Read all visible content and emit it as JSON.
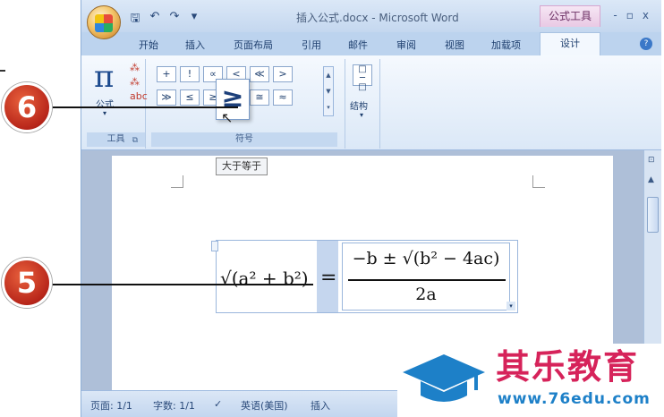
{
  "window": {
    "title": "插入公式.docx - Microsoft Word",
    "context_tab_group": "公式工具",
    "controls": [
      "-",
      "▫",
      "x"
    ]
  },
  "quick_access": [
    "save-icon",
    "undo-icon",
    "redo-icon",
    "customize-icon"
  ],
  "tabs": [
    {
      "label": "开始"
    },
    {
      "label": "插入"
    },
    {
      "label": "页面布局"
    },
    {
      "label": "引用"
    },
    {
      "label": "邮件"
    },
    {
      "label": "审阅"
    },
    {
      "label": "视图"
    },
    {
      "label": "加载项"
    },
    {
      "label": "设计",
      "active": true
    }
  ],
  "ribbon": {
    "tools": {
      "big_icon": "π",
      "button_label": "公式",
      "group_label": "工具"
    },
    "symbols": {
      "group_label": "符号",
      "row1": [
        "+",
        "!",
        "∝",
        "<",
        "≪",
        ">"
      ],
      "row2": [
        "≫",
        "≤",
        "≥",
        "∓",
        "≅",
        "≈"
      ],
      "hovered": "≥"
    },
    "structures": {
      "button_label": "结构"
    }
  },
  "tooltip": "大于等于",
  "equation": {
    "left": "√(a² + b²)",
    "equals": "=",
    "numerator": "−b ± √(b² − 4ac)",
    "denominator": "2a"
  },
  "statusbar": {
    "page": "页面: 1/1",
    "words": "字数: 1/1",
    "language": "英语(美国)",
    "mode": "插入"
  },
  "callouts": {
    "step6": "6",
    "step5": "5"
  },
  "watermark": {
    "brand": "其乐教育",
    "url": "www.76edu.com"
  },
  "colors": {
    "accent": "#1c4a8e",
    "badge": "#b8261a",
    "brand": "#d6235a",
    "url": "#1d80c8"
  }
}
